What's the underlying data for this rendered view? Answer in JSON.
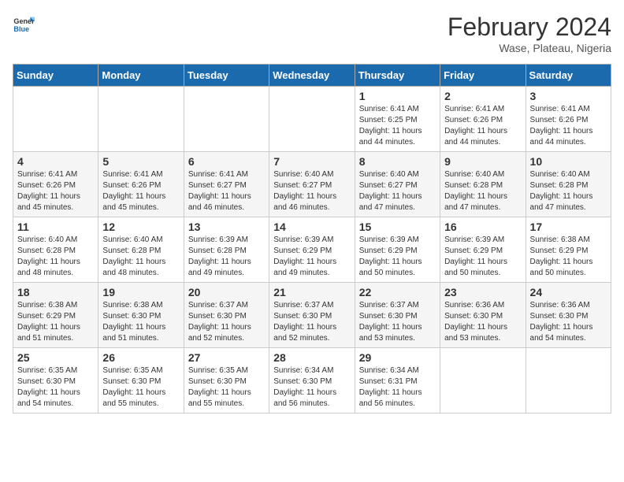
{
  "header": {
    "logo_general": "General",
    "logo_blue": "Blue",
    "title": "February 2024",
    "subtitle": "Wase, Plateau, Nigeria"
  },
  "calendar": {
    "weekdays": [
      "Sunday",
      "Monday",
      "Tuesday",
      "Wednesday",
      "Thursday",
      "Friday",
      "Saturday"
    ],
    "weeks": [
      [
        {
          "day": "",
          "info": ""
        },
        {
          "day": "",
          "info": ""
        },
        {
          "day": "",
          "info": ""
        },
        {
          "day": "",
          "info": ""
        },
        {
          "day": "1",
          "info": "Sunrise: 6:41 AM\nSunset: 6:25 PM\nDaylight: 11 hours and 44 minutes."
        },
        {
          "day": "2",
          "info": "Sunrise: 6:41 AM\nSunset: 6:26 PM\nDaylight: 11 hours and 44 minutes."
        },
        {
          "day": "3",
          "info": "Sunrise: 6:41 AM\nSunset: 6:26 PM\nDaylight: 11 hours and 44 minutes."
        }
      ],
      [
        {
          "day": "4",
          "info": "Sunrise: 6:41 AM\nSunset: 6:26 PM\nDaylight: 11 hours and 45 minutes."
        },
        {
          "day": "5",
          "info": "Sunrise: 6:41 AM\nSunset: 6:26 PM\nDaylight: 11 hours and 45 minutes."
        },
        {
          "day": "6",
          "info": "Sunrise: 6:41 AM\nSunset: 6:27 PM\nDaylight: 11 hours and 46 minutes."
        },
        {
          "day": "7",
          "info": "Sunrise: 6:40 AM\nSunset: 6:27 PM\nDaylight: 11 hours and 46 minutes."
        },
        {
          "day": "8",
          "info": "Sunrise: 6:40 AM\nSunset: 6:27 PM\nDaylight: 11 hours and 47 minutes."
        },
        {
          "day": "9",
          "info": "Sunrise: 6:40 AM\nSunset: 6:28 PM\nDaylight: 11 hours and 47 minutes."
        },
        {
          "day": "10",
          "info": "Sunrise: 6:40 AM\nSunset: 6:28 PM\nDaylight: 11 hours and 47 minutes."
        }
      ],
      [
        {
          "day": "11",
          "info": "Sunrise: 6:40 AM\nSunset: 6:28 PM\nDaylight: 11 hours and 48 minutes."
        },
        {
          "day": "12",
          "info": "Sunrise: 6:40 AM\nSunset: 6:28 PM\nDaylight: 11 hours and 48 minutes."
        },
        {
          "day": "13",
          "info": "Sunrise: 6:39 AM\nSunset: 6:28 PM\nDaylight: 11 hours and 49 minutes."
        },
        {
          "day": "14",
          "info": "Sunrise: 6:39 AM\nSunset: 6:29 PM\nDaylight: 11 hours and 49 minutes."
        },
        {
          "day": "15",
          "info": "Sunrise: 6:39 AM\nSunset: 6:29 PM\nDaylight: 11 hours and 50 minutes."
        },
        {
          "day": "16",
          "info": "Sunrise: 6:39 AM\nSunset: 6:29 PM\nDaylight: 11 hours and 50 minutes."
        },
        {
          "day": "17",
          "info": "Sunrise: 6:38 AM\nSunset: 6:29 PM\nDaylight: 11 hours and 50 minutes."
        }
      ],
      [
        {
          "day": "18",
          "info": "Sunrise: 6:38 AM\nSunset: 6:29 PM\nDaylight: 11 hours and 51 minutes."
        },
        {
          "day": "19",
          "info": "Sunrise: 6:38 AM\nSunset: 6:30 PM\nDaylight: 11 hours and 51 minutes."
        },
        {
          "day": "20",
          "info": "Sunrise: 6:37 AM\nSunset: 6:30 PM\nDaylight: 11 hours and 52 minutes."
        },
        {
          "day": "21",
          "info": "Sunrise: 6:37 AM\nSunset: 6:30 PM\nDaylight: 11 hours and 52 minutes."
        },
        {
          "day": "22",
          "info": "Sunrise: 6:37 AM\nSunset: 6:30 PM\nDaylight: 11 hours and 53 minutes."
        },
        {
          "day": "23",
          "info": "Sunrise: 6:36 AM\nSunset: 6:30 PM\nDaylight: 11 hours and 53 minutes."
        },
        {
          "day": "24",
          "info": "Sunrise: 6:36 AM\nSunset: 6:30 PM\nDaylight: 11 hours and 54 minutes."
        }
      ],
      [
        {
          "day": "25",
          "info": "Sunrise: 6:35 AM\nSunset: 6:30 PM\nDaylight: 11 hours and 54 minutes."
        },
        {
          "day": "26",
          "info": "Sunrise: 6:35 AM\nSunset: 6:30 PM\nDaylight: 11 hours and 55 minutes."
        },
        {
          "day": "27",
          "info": "Sunrise: 6:35 AM\nSunset: 6:30 PM\nDaylight: 11 hours and 55 minutes."
        },
        {
          "day": "28",
          "info": "Sunrise: 6:34 AM\nSunset: 6:30 PM\nDaylight: 11 hours and 56 minutes."
        },
        {
          "day": "29",
          "info": "Sunrise: 6:34 AM\nSunset: 6:31 PM\nDaylight: 11 hours and 56 minutes."
        },
        {
          "day": "",
          "info": ""
        },
        {
          "day": "",
          "info": ""
        }
      ]
    ]
  }
}
